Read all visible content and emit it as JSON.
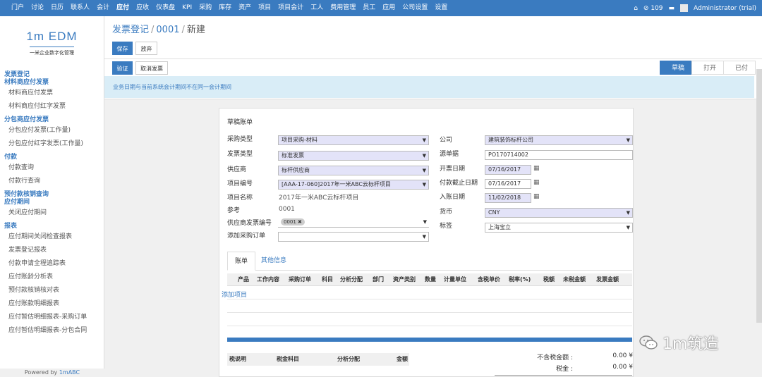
{
  "topnav": {
    "items": [
      "门户",
      "讨论",
      "日历",
      "联系人",
      "会计",
      "应付",
      "应收",
      "仪表盘",
      "KPI",
      "采购",
      "库存",
      "资产",
      "项目",
      "项目会计",
      "工人",
      "费用管理",
      "员工",
      "应用",
      "公司设置",
      "设置"
    ],
    "active": "应付",
    "message_count": "109",
    "user": "Administrator (trial)"
  },
  "sidebar": {
    "logo": "1m EDM",
    "logo_sub": "一米企业数字化管理",
    "sections": [
      {
        "title": "发票登记",
        "items": []
      },
      {
        "title": "材料商应付发票",
        "items": [
          "材料商应付发票",
          "材料商应付红字发票"
        ]
      },
      {
        "title": "分包商应付发票",
        "items": [
          "分包应付发票(工作量)",
          "分包应付红字发票(工作量)"
        ]
      },
      {
        "title": "付款",
        "items": [
          "付款查询",
          "付款行查询"
        ]
      },
      {
        "title": "预付款核销查询",
        "items": []
      },
      {
        "title": "应付期间",
        "items": [
          "关闭应付期间"
        ]
      },
      {
        "title": "报表",
        "items": [
          "应付期间关闭检查报表",
          "发票登记报表",
          "付款申请全程追踪表",
          "应付账龄分析表",
          "预付款核销核对表",
          "应付账款明细报表",
          "应付暂估明细报表-采购订单",
          "应付暂估明细报表-分包合同"
        ]
      }
    ],
    "powered": "Powered by",
    "powered_brand": "1mABC"
  },
  "header": {
    "crumb1": "发票登记",
    "crumb2": "0001",
    "crumb3": "新建",
    "save": "保存",
    "discard": "放弃",
    "validate": "验证",
    "cancel_invoice": "取消发票",
    "status": [
      "草稿",
      "打开",
      "已付"
    ],
    "alert": "业务日期与当前系统会计期间不在同一会计期间"
  },
  "form": {
    "title": "草稿账单",
    "purchase_type_label": "采购类型",
    "purchase_type": "项目采购-材料",
    "invoice_type_label": "发票类型",
    "invoice_type": "标准发票",
    "vendor_label": "供应商",
    "vendor": "标杆供应商",
    "project_code_label": "项目编号",
    "project_code": "[AAA-17-060]2017年一米ABC云标杆项目",
    "project_name_label": "项目名称",
    "project_name": "2017年一米ABC云标杆项目",
    "reference_label": "参考",
    "reference": "0001",
    "vendor_invoice_label": "供应商发票编号",
    "vendor_invoice_tag": "0001",
    "add_po_label": "添加采购订单",
    "company_label": "公司",
    "company": "建筑装饰标杆公司",
    "source_label": "源单据",
    "source": "PO170714002",
    "invoice_date_label": "开票日期",
    "invoice_date": "07/16/2017",
    "due_date_label": "付款截止日期",
    "due_date": "07/16/2017",
    "account_date_label": "入账日期",
    "account_date": "11/02/2018",
    "currency_label": "货币",
    "currency": "CNY",
    "tag_label": "标签",
    "tag": "上海宝立"
  },
  "tabs": [
    "账单",
    "其他信息"
  ],
  "lines": {
    "columns": [
      "产品",
      "工作内容",
      "采购订单",
      "科目",
      "分析分配",
      "部门",
      "资产类别",
      "数量",
      "计量单位",
      "含税单价",
      "税率(%)",
      "税额",
      "未税金额",
      "发票金额"
    ],
    "add_line": "添加项目"
  },
  "tax": {
    "columns": [
      "税说明",
      "税金科目",
      "分析分配",
      "金额"
    ]
  },
  "totals": {
    "untaxed_label": "不含税金额 :",
    "untaxed": "0.00 ¥",
    "tax_label": "税金 :",
    "tax": "0.00 ¥"
  },
  "watermark": "1m筑造"
}
